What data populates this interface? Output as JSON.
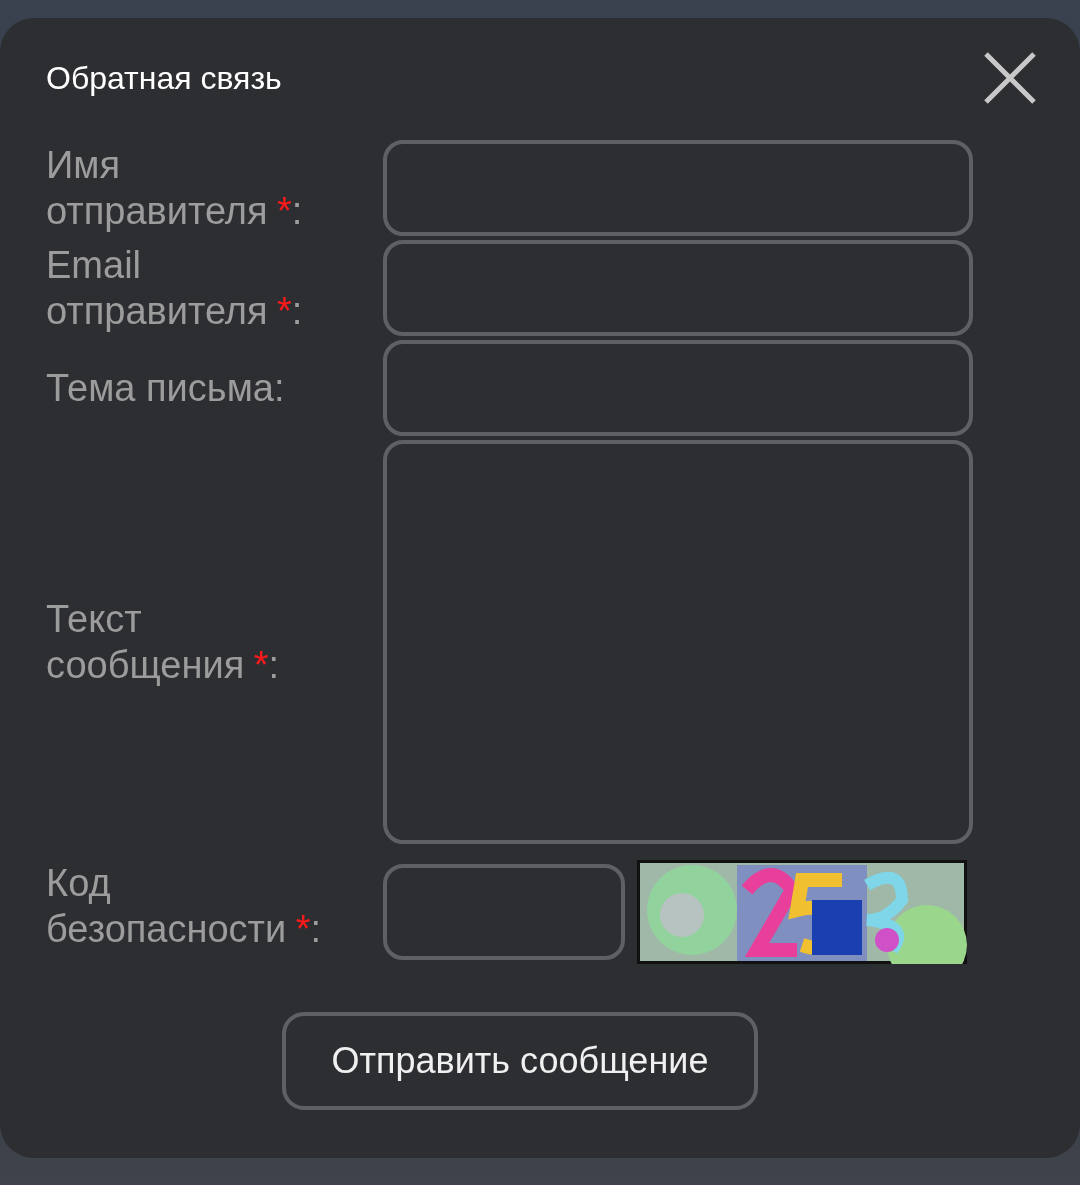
{
  "dialog": {
    "title": "Обратная связь",
    "fields": [
      {
        "kind": "input",
        "label": "Имя отправителя",
        "required_mark": "*",
        "colon": ":"
      },
      {
        "kind": "input",
        "label": "Email отправителя",
        "required_mark": "*",
        "colon": ":"
      },
      {
        "kind": "input",
        "label": "Тема письма",
        "colon": ":"
      },
      {
        "kind": "textarea",
        "label": "Текст сообщения",
        "required_mark": "*",
        "colon": ":"
      },
      {
        "kind": "captcha",
        "label": "Код безопасности",
        "required_mark": "*",
        "colon": ":"
      }
    ],
    "submit": "Отправить сообщение"
  }
}
